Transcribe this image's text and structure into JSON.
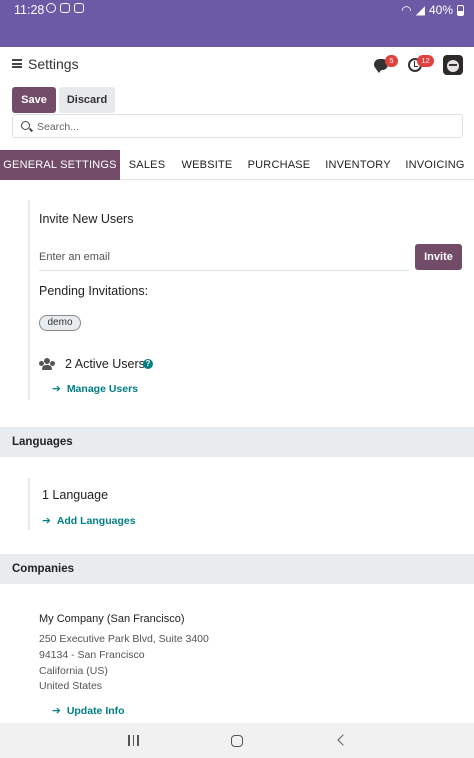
{
  "status_bar": {
    "time": "11:28",
    "battery": "40%"
  },
  "header": {
    "title": "Settings",
    "messages_badge": "5",
    "activity_badge": "12"
  },
  "toolbar": {
    "save_label": "Save",
    "discard_label": "Discard"
  },
  "search": {
    "placeholder": "Search..."
  },
  "tabs": [
    "GENERAL SETTINGS",
    "SALES",
    "WEBSITE",
    "PURCHASE",
    "INVENTORY",
    "INVOICING"
  ],
  "users": {
    "invite_title": "Invite New Users",
    "email_placeholder": "Enter an email",
    "invite_button": "Invite",
    "pending_title": "Pending Invitations:",
    "pending_chip": "demo",
    "active_users": "2 Active Users",
    "manage_link": "Manage Users"
  },
  "languages": {
    "header": "Languages",
    "count": "1 Language",
    "add_link": "Add Languages"
  },
  "companies": {
    "header": "Companies",
    "name": "My Company (San Francisco)",
    "address": [
      "250 Executive Park Blvd, Suite 3400",
      "94134 - San Francisco",
      "California (US)",
      "United States"
    ],
    "update_link": "Update Info"
  },
  "colors": {
    "status_bar": "#6d5aa6",
    "primary": "#714b67",
    "link": "#017e84",
    "badge": "#e0413e"
  }
}
